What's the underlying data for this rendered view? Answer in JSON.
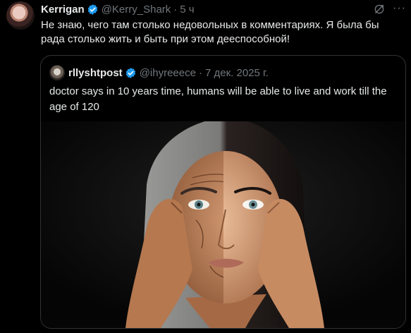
{
  "tweet": {
    "author_name": "Kerrigan",
    "author_handle": "@Kerry_Shark",
    "separator": "·",
    "time": "5 ч",
    "more_label": "···",
    "text": "Не знаю, чего там столько недовольных в комментариях. Я была бы рада столько жить и быть при этом дееспособной!"
  },
  "quoted": {
    "author_name": "rllyshtpost",
    "author_handle": "@ihyreeece",
    "separator": "·",
    "time": "7 дек. 2025 г.",
    "text": "doctor says in 10 years time, humans will be able to live and work till the age of 120",
    "media_icon": "face-aging-photo"
  },
  "colors": {
    "background": "#000000",
    "text": "#e7e9ea",
    "muted": "#71767b",
    "verified": "#1d9bf0",
    "border": "#2f3336"
  },
  "icons": {
    "verified": "verified-badge-icon",
    "grok": "grok-icon",
    "more": "more-icon"
  }
}
